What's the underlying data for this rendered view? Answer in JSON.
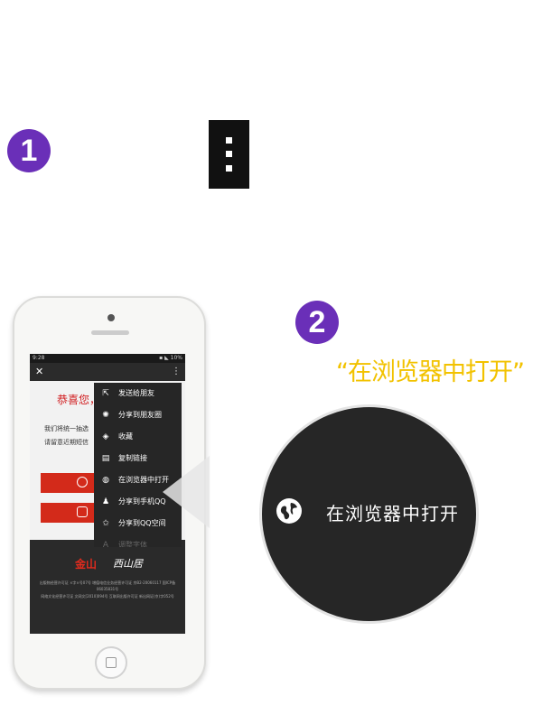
{
  "steps": {
    "one": "1",
    "two": "2"
  },
  "quote_text": "“在浏览器中打开”",
  "phone": {
    "status_time": "9:28",
    "status_icons": "▪ ◣ 10%",
    "close_glyph": "✕",
    "more_glyph": "⋮",
    "congrats": "恭喜您，",
    "line1": "我们将统一抽选",
    "line2": "请留意近期短信",
    "footer_logo_main": "金山",
    "footer_logo_sub": "KINGSOFT",
    "footer_logo_partner": "西山居",
    "footer_line1": "出版物经营许可证 ×字×号07号  增值电信业务经营许可证 京B2-20060117  国ICP备",
    "footer_line2": "06035831号",
    "footer_line3": "网络文化经营许可证 文网文[2010]094号  互联网出版许可证 新出网证(京)字052号"
  },
  "menu": {
    "items": [
      {
        "label": "发送给朋友",
        "icon": "share-out-icon"
      },
      {
        "label": "分享到朋友圈",
        "icon": "moments-icon"
      },
      {
        "label": "收藏",
        "icon": "favorite-box-icon"
      },
      {
        "label": "复制链接",
        "icon": "copy-link-icon"
      },
      {
        "label": "在浏览器中打开",
        "icon": "globe-icon"
      },
      {
        "label": "分享到手机QQ",
        "icon": "qq-penguin-icon"
      },
      {
        "label": "分享到QQ空间",
        "icon": "star-icon"
      },
      {
        "label": "调整字体",
        "icon": "font-size-icon"
      }
    ]
  },
  "zoom": {
    "label": "在浏览器中打开",
    "icon": "globe-icon"
  },
  "colors": {
    "accent_purple": "#6a2fb8",
    "quote_yellow": "#f2c200",
    "menu_bg": "#262626",
    "brand_red": "#d32a1a"
  }
}
